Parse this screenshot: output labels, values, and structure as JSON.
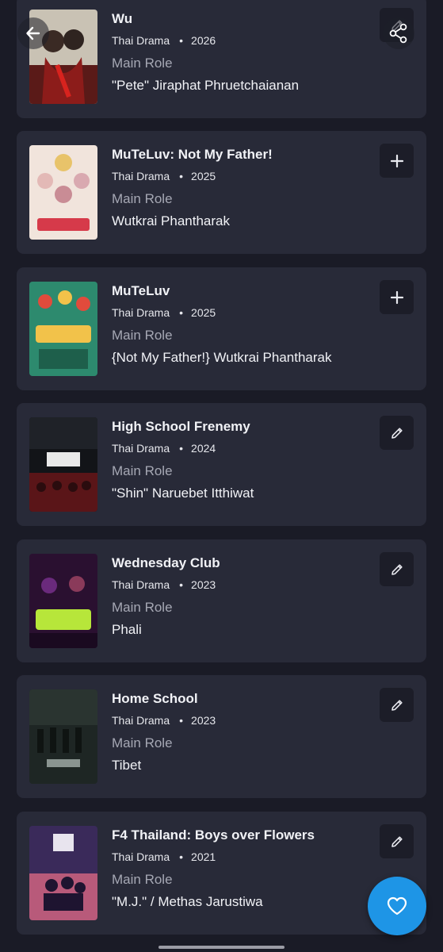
{
  "colors": {
    "background": "#1a1b26",
    "card": "#282a38",
    "button": "#1c1d28",
    "fab": "#1e95e6"
  },
  "header": {
    "back_icon": "arrow-left-icon",
    "share_icon": "share-icon"
  },
  "items": [
    {
      "title": "Wu",
      "type": "Thai Drama",
      "year": "2026",
      "role_label": "Main Role",
      "role_name": "\"Pete\" Jiraphat Phruetchaianan",
      "action": "edit"
    },
    {
      "title": "MuTeLuv: Not My Father!",
      "type": "Thai Drama",
      "year": "2025",
      "role_label": "Main Role",
      "role_name": "Wutkrai Phantharak",
      "action": "add"
    },
    {
      "title": "MuTeLuv",
      "type": "Thai Drama",
      "year": "2025",
      "role_label": "Main Role",
      "role_name": "{Not My Father!} Wutkrai Phantharak",
      "action": "add"
    },
    {
      "title": "High School Frenemy",
      "type": "Thai Drama",
      "year": "2024",
      "role_label": "Main Role",
      "role_name": "\"Shin\" Naruebet Itthiwat",
      "action": "edit"
    },
    {
      "title": "Wednesday Club",
      "type": "Thai Drama",
      "year": "2023",
      "role_label": "Main Role",
      "role_name": "Phali",
      "action": "edit"
    },
    {
      "title": "Home School",
      "type": "Thai Drama",
      "year": "2023",
      "role_label": "Main Role",
      "role_name": "Tibet",
      "action": "edit"
    },
    {
      "title": "F4 Thailand: Boys over Flowers",
      "type": "Thai Drama",
      "year": "2021",
      "role_label": "Main Role",
      "role_name": "\"M.J.\" / Methas Jarustiwa",
      "action": "edit"
    }
  ],
  "separator": "•",
  "fab": {
    "icon": "heart-icon"
  }
}
